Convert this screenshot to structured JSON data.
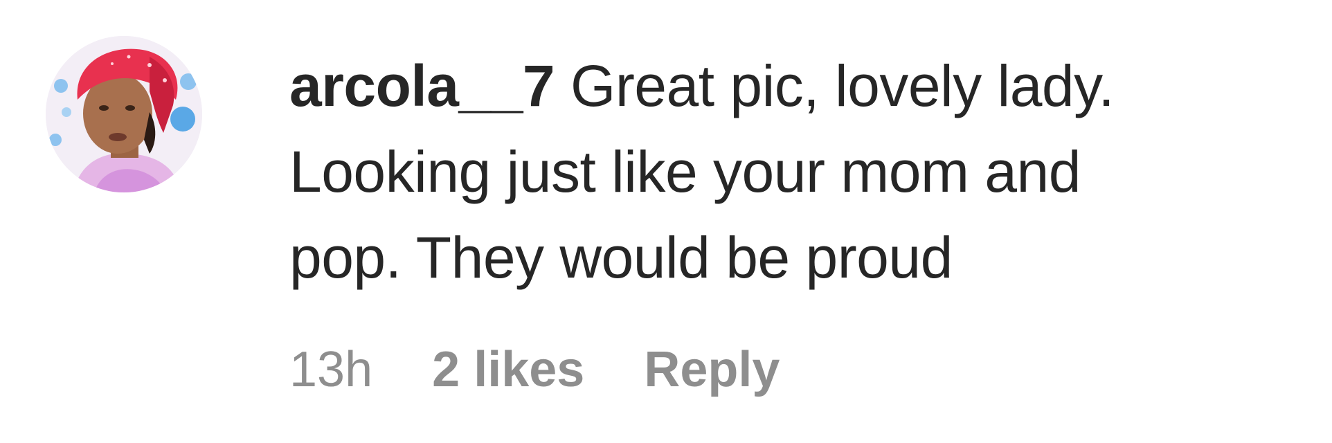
{
  "comment": {
    "username": "arcola__7",
    "line1": "Great pic, lovely lady.",
    "line2": "Looking just like your mom and",
    "line3": "pop. They would be proud",
    "time": "13h",
    "likes": "2 likes",
    "reply_label": "Reply"
  },
  "avatar": {
    "icon": "user-avatar",
    "colors": {
      "headwrap": "#e8314f",
      "skin": "#a8704e",
      "accent_blue": "#5aa8e6",
      "background": "#f3eef6"
    }
  }
}
